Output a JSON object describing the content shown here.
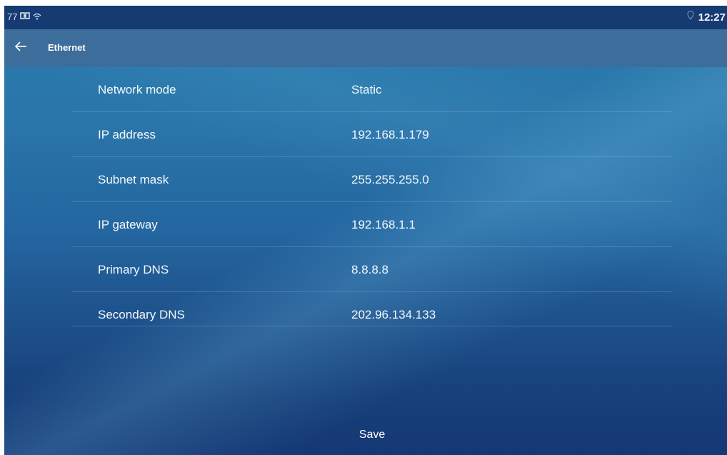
{
  "status_bar": {
    "left_text": "77",
    "time": "12:27",
    "icons": [
      "sim-icon",
      "wifi-icon",
      "location-icon"
    ]
  },
  "title_bar": {
    "back_icon": "arrow-left-icon",
    "title": "Ethernet"
  },
  "settings": [
    {
      "label": "Network mode",
      "value": "Static"
    },
    {
      "label": "IP address",
      "value": "192.168.1.179"
    },
    {
      "label": "Subnet mask",
      "value": "255.255.255.0"
    },
    {
      "label": "IP gateway",
      "value": "192.168.1.1"
    },
    {
      "label": "Primary DNS",
      "value": "8.8.8.8"
    },
    {
      "label": "Secondary DNS",
      "value": "202.96.134.133"
    }
  ],
  "actions": {
    "save_label": "Save"
  },
  "colors": {
    "status_bar_bg": "#163a72",
    "title_bar_bg": "#3d6d9b",
    "content_top": "#2b79ad",
    "content_bottom": "#153874",
    "text": "#f4f8fb"
  }
}
